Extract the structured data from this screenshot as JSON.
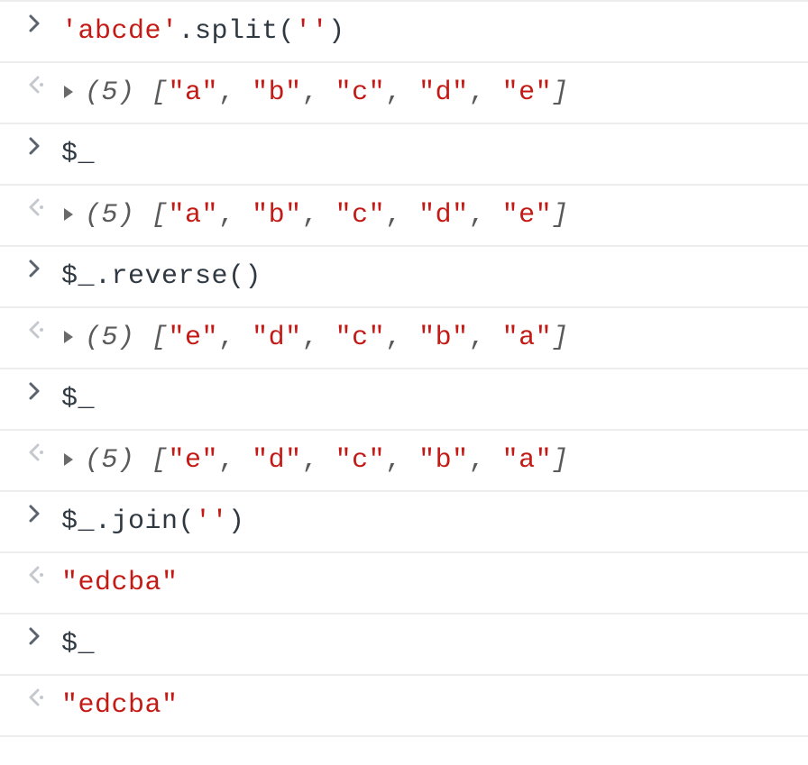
{
  "lines": [
    {
      "kind": "input",
      "spans": [
        {
          "cls": "tok-str",
          "text": "'abcde'"
        },
        {
          "cls": "tok-plain",
          "text": ".split("
        },
        {
          "cls": "tok-str",
          "text": "''"
        },
        {
          "cls": "tok-plain",
          "text": ")"
        }
      ]
    },
    {
      "kind": "output",
      "expandable": true,
      "array": {
        "count": "(5)",
        "items": [
          "\"a\"",
          "\"b\"",
          "\"c\"",
          "\"d\"",
          "\"e\""
        ]
      }
    },
    {
      "kind": "input",
      "spans": [
        {
          "cls": "tok-plain",
          "text": "$_"
        }
      ]
    },
    {
      "kind": "output",
      "expandable": true,
      "array": {
        "count": "(5)",
        "items": [
          "\"a\"",
          "\"b\"",
          "\"c\"",
          "\"d\"",
          "\"e\""
        ]
      }
    },
    {
      "kind": "input",
      "spans": [
        {
          "cls": "tok-plain",
          "text": "$_.reverse()"
        }
      ]
    },
    {
      "kind": "output",
      "expandable": true,
      "array": {
        "count": "(5)",
        "items": [
          "\"e\"",
          "\"d\"",
          "\"c\"",
          "\"b\"",
          "\"a\""
        ]
      }
    },
    {
      "kind": "input",
      "spans": [
        {
          "cls": "tok-plain",
          "text": "$_"
        }
      ]
    },
    {
      "kind": "output",
      "expandable": true,
      "array": {
        "count": "(5)",
        "items": [
          "\"e\"",
          "\"d\"",
          "\"c\"",
          "\"b\"",
          "\"a\""
        ]
      }
    },
    {
      "kind": "input",
      "spans": [
        {
          "cls": "tok-plain",
          "text": "$_.join("
        },
        {
          "cls": "tok-str",
          "text": "''"
        },
        {
          "cls": "tok-plain",
          "text": ")"
        }
      ]
    },
    {
      "kind": "output",
      "expandable": false,
      "spans": [
        {
          "cls": "tok-str",
          "text": "\"edcba\""
        }
      ]
    },
    {
      "kind": "input",
      "spans": [
        {
          "cls": "tok-plain",
          "text": "$_"
        }
      ]
    },
    {
      "kind": "output",
      "expandable": false,
      "spans": [
        {
          "cls": "tok-str",
          "text": "\"edcba\""
        }
      ]
    }
  ]
}
